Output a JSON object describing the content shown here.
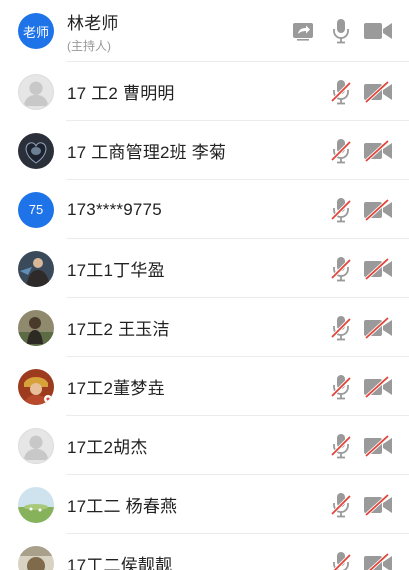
{
  "participants": [
    {
      "name": "林老师",
      "role": "(主持人)",
      "avatar_type": "text",
      "avatar_text": "老师",
      "mic": "on",
      "camera": "on",
      "screen_share": true
    },
    {
      "name": "17 工2 曹明明",
      "avatar_type": "default",
      "mic": "muted",
      "camera": "off"
    },
    {
      "name": "17 工商管理2班 李菊",
      "avatar_type": "photo",
      "mic": "muted",
      "camera": "off"
    },
    {
      "name": "173****9775",
      "avatar_type": "text",
      "avatar_text": "75",
      "mic": "muted",
      "camera": "off"
    },
    {
      "name": "17工1丁华盈",
      "avatar_type": "photo",
      "mic": "muted",
      "camera": "off"
    },
    {
      "name": "17工2 王玉洁",
      "avatar_type": "photo",
      "mic": "muted",
      "camera": "off"
    },
    {
      "name": "17工2董梦垚",
      "avatar_type": "photo",
      "mic": "muted",
      "camera": "off"
    },
    {
      "name": "17工2胡杰",
      "avatar_type": "default",
      "mic": "muted",
      "camera": "off"
    },
    {
      "name": "17工二 杨春燕",
      "avatar_type": "photo",
      "mic": "muted",
      "camera": "off"
    },
    {
      "name": "17工二侯靓靓",
      "avatar_type": "photo",
      "mic": "muted",
      "camera": "off"
    }
  ],
  "colors": {
    "accent": "#1e73e8",
    "icon_gray": "#9a9a9a",
    "muted_red": "#e0443a"
  }
}
